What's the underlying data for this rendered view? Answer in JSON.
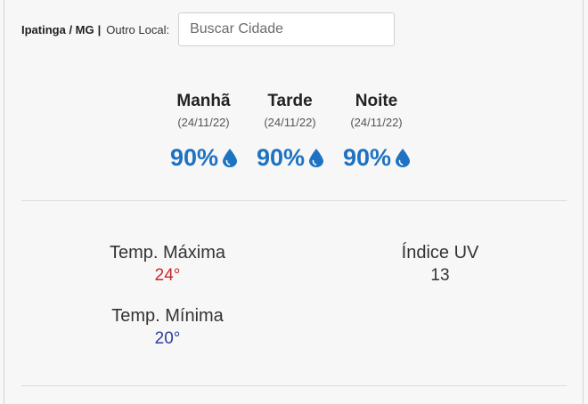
{
  "location": {
    "city": "Ipatinga / MG",
    "separator": "|",
    "other_label": "Outro Local:",
    "search_placeholder": "Buscar Cidade"
  },
  "periods": [
    {
      "name": "Manhã",
      "date": "(24/11/22)",
      "rain": "90%"
    },
    {
      "name": "Tarde",
      "date": "(24/11/22)",
      "rain": "90%"
    },
    {
      "name": "Noite",
      "date": "(24/11/22)",
      "rain": "90%"
    }
  ],
  "colors": {
    "rain": "#1e72c2",
    "max_temp": "#c62828",
    "min_temp": "#2c3e9e"
  },
  "icons": {
    "rain": "water-drop-icon"
  },
  "temperatures": {
    "max_label": "Temp. Máxima",
    "max_value": "24°",
    "min_label": "Temp. Mínima",
    "min_value": "20°"
  },
  "uv": {
    "label": "Índice UV",
    "value": "13"
  }
}
